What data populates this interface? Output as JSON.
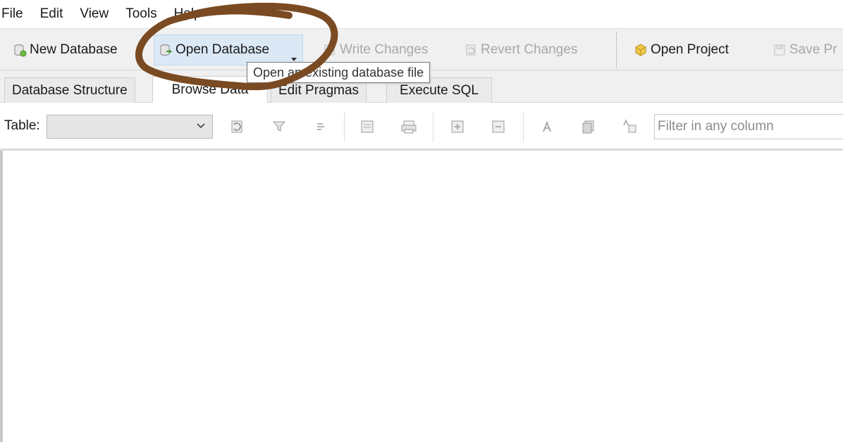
{
  "menu": [
    "File",
    "Edit",
    "View",
    "Tools",
    "Help"
  ],
  "toolbar": {
    "new_database": "New Database",
    "open_database": "Open Database",
    "write_changes": "Write Changes",
    "revert_changes": "Revert Changes",
    "open_project": "Open Project",
    "save_project": "Save Pr"
  },
  "tooltip": "Open an existing database file",
  "tabs": [
    "Database Structure",
    "Browse Data",
    "Edit Pragmas",
    "Execute SQL"
  ],
  "browse": {
    "table_label": "Table:",
    "filter_placeholder": "Filter in any column"
  },
  "colors": {
    "annotation": "#7a4a22",
    "hover": "#dbe8f6"
  },
  "icons": [
    "new-db-icon",
    "open-db-icon",
    "write-icon",
    "revert-icon",
    "open-project-icon",
    "save-project-icon"
  ]
}
